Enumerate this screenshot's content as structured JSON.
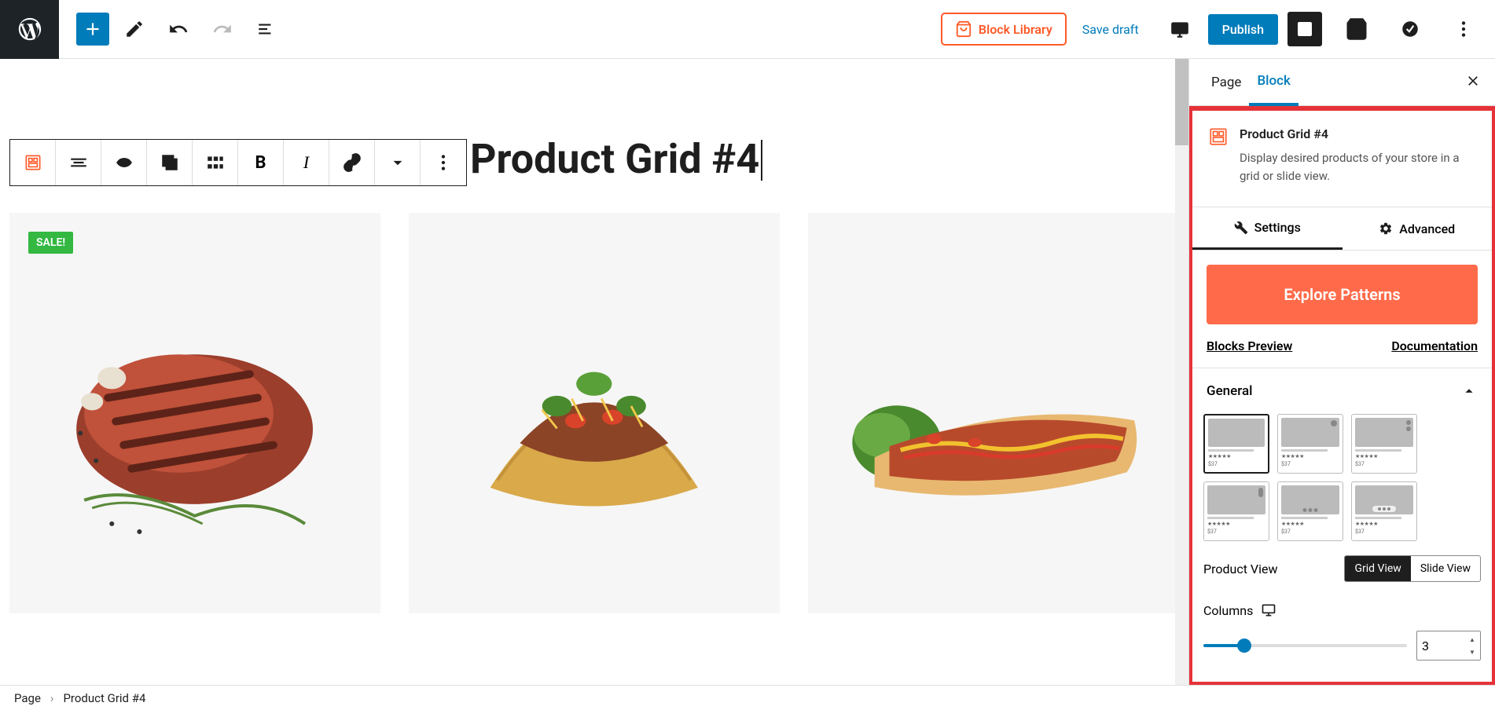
{
  "topbar": {
    "block_library": "Block Library",
    "save_draft": "Save draft",
    "publish": "Publish"
  },
  "canvas": {
    "heading": "Product Grid #4",
    "sale_badge": "SALE!"
  },
  "sidebar": {
    "tab_page": "Page",
    "tab_block": "Block",
    "block_title": "Product Grid #4",
    "block_desc": "Display desired products of your store in a grid or slide view.",
    "tab_settings": "Settings",
    "tab_advanced": "Advanced",
    "explore": "Explore Patterns",
    "blocks_preview": "Blocks Preview",
    "documentation": "Documentation",
    "general": "General",
    "product_view_label": "Product View",
    "grid_view": "Grid View",
    "slide_view": "Slide View",
    "columns_label": "Columns",
    "columns_value": "3"
  },
  "footer": {
    "crumb1": "Page",
    "crumb2": "Product Grid #4"
  }
}
